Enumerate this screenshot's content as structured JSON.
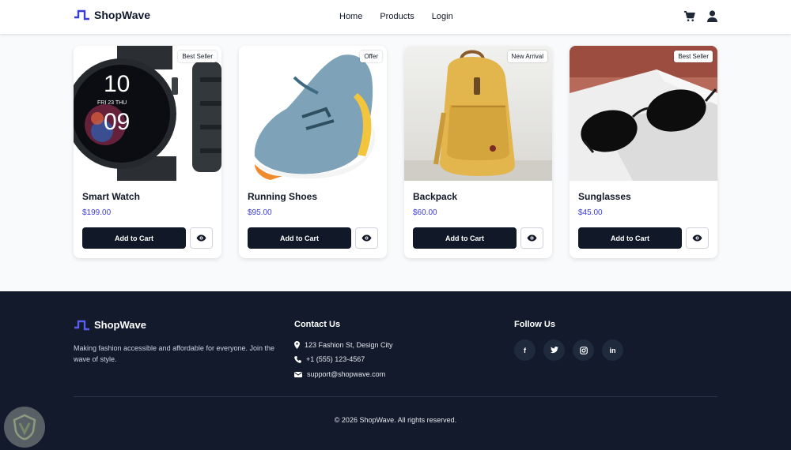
{
  "header": {
    "brand": "ShopWave",
    "nav": [
      "Home",
      "Products",
      "Login"
    ],
    "icons": [
      "cart-icon",
      "user-icon"
    ]
  },
  "products": [
    {
      "name": "Smart Watch",
      "price": "$199.00",
      "badge": "Best Seller",
      "button": "Add to Cart"
    },
    {
      "name": "Running Shoes",
      "price": "$95.00",
      "badge": "Offer",
      "button": "Add to Cart"
    },
    {
      "name": "Backpack",
      "price": "$60.00",
      "badge": "New Arrival",
      "button": "Add to Cart"
    },
    {
      "name": "Sunglasses",
      "price": "$45.00",
      "badge": "Best Seller",
      "button": "Add to Cart"
    }
  ],
  "footer": {
    "brand": "ShopWave",
    "description": "Making fashion accessible and affordable for everyone. Join the wave of style.",
    "contact_heading": "Contact Us",
    "address": "123 Fashion St, Design City",
    "phone": "+1 (555) 123-4567",
    "email": "support@shopwave.com",
    "follow_heading": "Follow Us",
    "social": [
      {
        "icon": "facebook-icon",
        "glyph": "f"
      },
      {
        "icon": "twitter-icon",
        "glyph": ""
      },
      {
        "icon": "instagram-icon",
        "glyph": ""
      },
      {
        "icon": "linkedin-icon",
        "glyph": "in"
      }
    ],
    "copyright": "© 2026 ShopWave. All rights reserved."
  },
  "colors": {
    "primary": "#111827",
    "accent": "#3b3bd8",
    "footer_bg": "#121a2c"
  }
}
